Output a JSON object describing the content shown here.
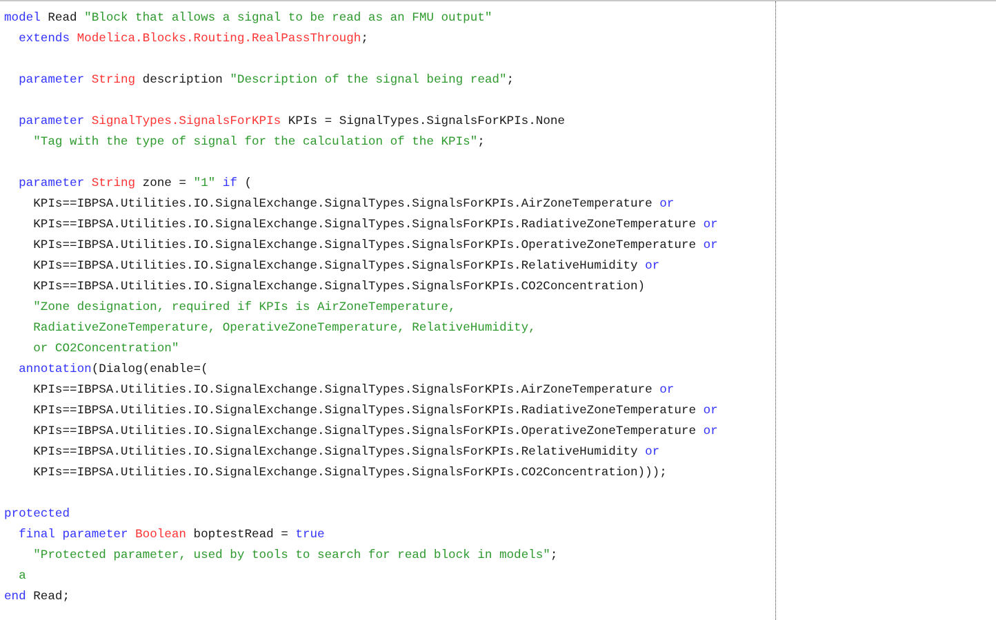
{
  "editor": {
    "language": "Modelica",
    "colors": {
      "keyword": "#3333ff",
      "type": "#ff3333",
      "string": "#2e9a2e",
      "text": "#1a1a1a",
      "guide_line": "#404040"
    },
    "lines": [
      [
        {
          "c": "kw",
          "t": "model"
        },
        {
          "c": "plain",
          "t": " Read "
        },
        {
          "c": "str",
          "t": "\"Block that allows a signal to be read as an FMU output\""
        }
      ],
      [
        {
          "c": "plain",
          "t": "  "
        },
        {
          "c": "kw",
          "t": "extends"
        },
        {
          "c": "plain",
          "t": " "
        },
        {
          "c": "type",
          "t": "Modelica.Blocks.Routing.RealPassThrough"
        },
        {
          "c": "plain",
          "t": ";"
        }
      ],
      [],
      [
        {
          "c": "plain",
          "t": "  "
        },
        {
          "c": "kw",
          "t": "parameter"
        },
        {
          "c": "plain",
          "t": " "
        },
        {
          "c": "type",
          "t": "String"
        },
        {
          "c": "plain",
          "t": " description "
        },
        {
          "c": "str",
          "t": "\"Description of the signal being read\""
        },
        {
          "c": "plain",
          "t": ";"
        }
      ],
      [],
      [
        {
          "c": "plain",
          "t": "  "
        },
        {
          "c": "kw",
          "t": "parameter"
        },
        {
          "c": "plain",
          "t": " "
        },
        {
          "c": "type",
          "t": "SignalTypes.SignalsForKPIs"
        },
        {
          "c": "plain",
          "t": " KPIs = SignalTypes.SignalsForKPIs.None"
        }
      ],
      [
        {
          "c": "plain",
          "t": "    "
        },
        {
          "c": "str",
          "t": "\"Tag with the type of signal for the calculation of the KPIs\""
        },
        {
          "c": "plain",
          "t": ";"
        }
      ],
      [],
      [
        {
          "c": "plain",
          "t": "  "
        },
        {
          "c": "kw",
          "t": "parameter"
        },
        {
          "c": "plain",
          "t": " "
        },
        {
          "c": "type",
          "t": "String"
        },
        {
          "c": "plain",
          "t": " zone = "
        },
        {
          "c": "str",
          "t": "\"1\""
        },
        {
          "c": "plain",
          "t": " "
        },
        {
          "c": "kw",
          "t": "if"
        },
        {
          "c": "plain",
          "t": " ("
        }
      ],
      [
        {
          "c": "plain",
          "t": "    KPIs==IBPSA.Utilities.IO.SignalExchange.SignalTypes.SignalsForKPIs.AirZoneTemperature "
        },
        {
          "c": "kw",
          "t": "or"
        }
      ],
      [
        {
          "c": "plain",
          "t": "    KPIs==IBPSA.Utilities.IO.SignalExchange.SignalTypes.SignalsForKPIs.RadiativeZoneTemperature "
        },
        {
          "c": "kw",
          "t": "or"
        }
      ],
      [
        {
          "c": "plain",
          "t": "    KPIs==IBPSA.Utilities.IO.SignalExchange.SignalTypes.SignalsForKPIs.OperativeZoneTemperature "
        },
        {
          "c": "kw",
          "t": "or"
        }
      ],
      [
        {
          "c": "plain",
          "t": "    KPIs==IBPSA.Utilities.IO.SignalExchange.SignalTypes.SignalsForKPIs.RelativeHumidity "
        },
        {
          "c": "kw",
          "t": "or"
        }
      ],
      [
        {
          "c": "plain",
          "t": "    KPIs==IBPSA.Utilities.IO.SignalExchange.SignalTypes.SignalsForKPIs.CO2Concentration)"
        }
      ],
      [
        {
          "c": "plain",
          "t": "    "
        },
        {
          "c": "str",
          "t": "\"Zone designation, required if KPIs is AirZoneTemperature,"
        }
      ],
      [
        {
          "c": "plain",
          "t": "    "
        },
        {
          "c": "str",
          "t": "RadiativeZoneTemperature, OperativeZoneTemperature, RelativeHumidity,"
        }
      ],
      [
        {
          "c": "plain",
          "t": "    "
        },
        {
          "c": "str",
          "t": "or CO2Concentration\""
        }
      ],
      [
        {
          "c": "plain",
          "t": "  "
        },
        {
          "c": "kw",
          "t": "annotation"
        },
        {
          "c": "plain",
          "t": "(Dialog(enable=("
        }
      ],
      [
        {
          "c": "plain",
          "t": "    KPIs==IBPSA.Utilities.IO.SignalExchange.SignalTypes.SignalsForKPIs.AirZoneTemperature "
        },
        {
          "c": "kw",
          "t": "or"
        }
      ],
      [
        {
          "c": "plain",
          "t": "    KPIs==IBPSA.Utilities.IO.SignalExchange.SignalTypes.SignalsForKPIs.RadiativeZoneTemperature "
        },
        {
          "c": "kw",
          "t": "or"
        }
      ],
      [
        {
          "c": "plain",
          "t": "    KPIs==IBPSA.Utilities.IO.SignalExchange.SignalTypes.SignalsForKPIs.OperativeZoneTemperature "
        },
        {
          "c": "kw",
          "t": "or"
        }
      ],
      [
        {
          "c": "plain",
          "t": "    KPIs==IBPSA.Utilities.IO.SignalExchange.SignalTypes.SignalsForKPIs.RelativeHumidity "
        },
        {
          "c": "kw",
          "t": "or"
        }
      ],
      [
        {
          "c": "plain",
          "t": "    KPIs==IBPSA.Utilities.IO.SignalExchange.SignalTypes.SignalsForKPIs.CO2Concentration)));"
        }
      ],
      [],
      [
        {
          "c": "kw",
          "t": "protected"
        }
      ],
      [
        {
          "c": "plain",
          "t": "  "
        },
        {
          "c": "kw",
          "t": "final"
        },
        {
          "c": "plain",
          "t": " "
        },
        {
          "c": "kw",
          "t": "parameter"
        },
        {
          "c": "plain",
          "t": " "
        },
        {
          "c": "type",
          "t": "Boolean"
        },
        {
          "c": "plain",
          "t": " boptestRead = "
        },
        {
          "c": "kw",
          "t": "true"
        }
      ],
      [
        {
          "c": "plain",
          "t": "    "
        },
        {
          "c": "str",
          "t": "\"Protected parameter, used by tools to search for read block in models\""
        },
        {
          "c": "plain",
          "t": ";"
        }
      ],
      [
        {
          "c": "plain",
          "t": "  "
        },
        {
          "c": "str",
          "t": "a"
        }
      ],
      [
        {
          "c": "kw",
          "t": "end"
        },
        {
          "c": "plain",
          "t": " Read;"
        }
      ]
    ]
  }
}
